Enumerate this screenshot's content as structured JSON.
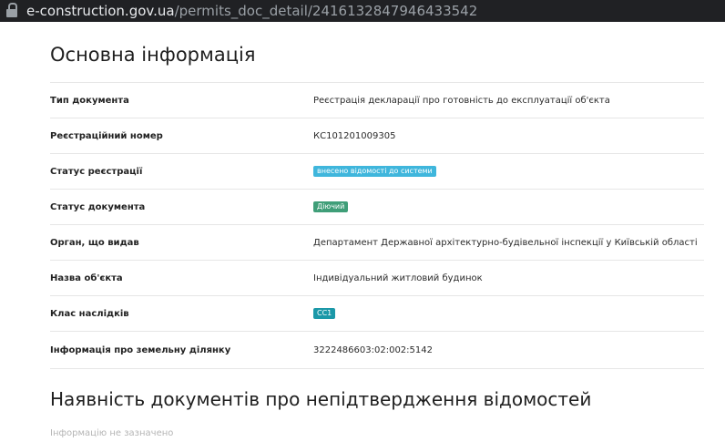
{
  "browser": {
    "url_host": "e-construction.gov.ua",
    "url_path": "/permits_doc_detail/2416132847946433542"
  },
  "main": {
    "title": "Основна інформація",
    "rows": [
      {
        "label": "Тип документа",
        "value": "Реєстрація декларації про готовність до експлуатації об'єкта"
      },
      {
        "label": "Реєстраційний номер",
        "value": "КС101201009305"
      },
      {
        "label": "Статус реєстрації",
        "value": "внесено відомості до системи",
        "badge": "#3fb6dc"
      },
      {
        "label": "Статус документа",
        "value": "Діючий",
        "badge": "#3f9e78"
      },
      {
        "label": "Орган, що видав",
        "value": "Департамент Державної архітектурно-будівельної інспекції у Київській області"
      },
      {
        "label": "Назва об'єкта",
        "value": "Індивідуальний житловий будинок"
      },
      {
        "label": "Клас наслідків",
        "value": "СС1",
        "badge": "#1b98a8"
      },
      {
        "label": "Інформація про земельну ділянку",
        "value": "3222486603:02:002:5142"
      }
    ],
    "section2_title": "Наявність документів про непідтвердження відомостей",
    "section2_note": "Інформацію не зазначено"
  }
}
